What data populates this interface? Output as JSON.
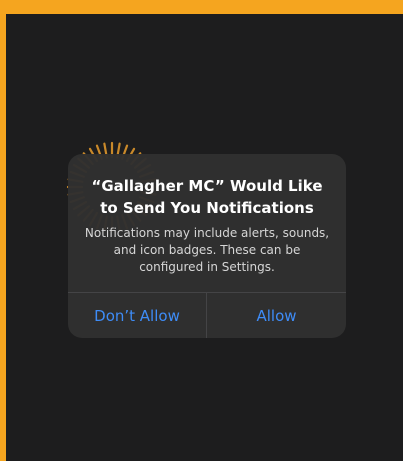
{
  "colors": {
    "border": "#f5a51f",
    "background": "#1d1d1e",
    "alert_background": "#2f2f2f",
    "button_text": "#3e8cf7",
    "logo": "#c9892a"
  },
  "app_icon": "gallagher-logo-icon",
  "alert": {
    "title": "“Gallagher MC” Would Like to Send You Notifications",
    "message": "Notifications may include alerts, sounds, and icon badges. These can be configured in Settings.",
    "buttons": {
      "deny_label": "Don’t Allow",
      "allow_label": "Allow"
    }
  }
}
